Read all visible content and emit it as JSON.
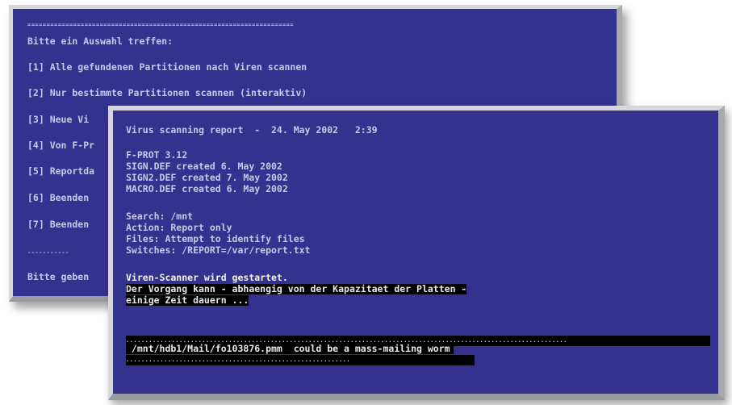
{
  "back_terminal": {
    "separator_top": "======================================================================",
    "prompt": "Bitte ein Auswahl treffen:",
    "menu": [
      "[1] Alle gefundenen Partitionen nach Viren scannen",
      "[2] Nur bestimmte Partitionen scannen (interaktiv)",
      "[3] Neue Vi",
      "[4] Von F-Pr",
      "[5] Reportda",
      "[6] Beenden",
      "[7] Beenden"
    ],
    "separator_bottom": "-----------",
    "input_prompt": "Bitte geben"
  },
  "front_terminal": {
    "header": "Virus scanning report  -  24. May 2002   2:39",
    "version": "F-PROT 3.12",
    "signatures": [
      "SIGN.DEF created 6. May 2002",
      "SIGN2.DEF created 7. May 2002",
      "MACRO.DEF created 6. May 2002"
    ],
    "params": [
      "Search: /mnt",
      "Action: Report only",
      "Files: Attempt to identify files",
      "Switches: /REPORT=/var/report.txt"
    ],
    "start_msg": "Viren-Scanner wird gestartet.",
    "warning_lines": [
      "Der Vorgang kann - abhaengig von der Kapazitaet der Platten -",
      "einige Zeit dauern ..."
    ],
    "dots_top": "....................................................................................................................",
    "result": " /mnt/hdb1/Mail/fo103876.pmm  could be a mass-mailing worm",
    "dots_bottom": "..........................................................."
  }
}
